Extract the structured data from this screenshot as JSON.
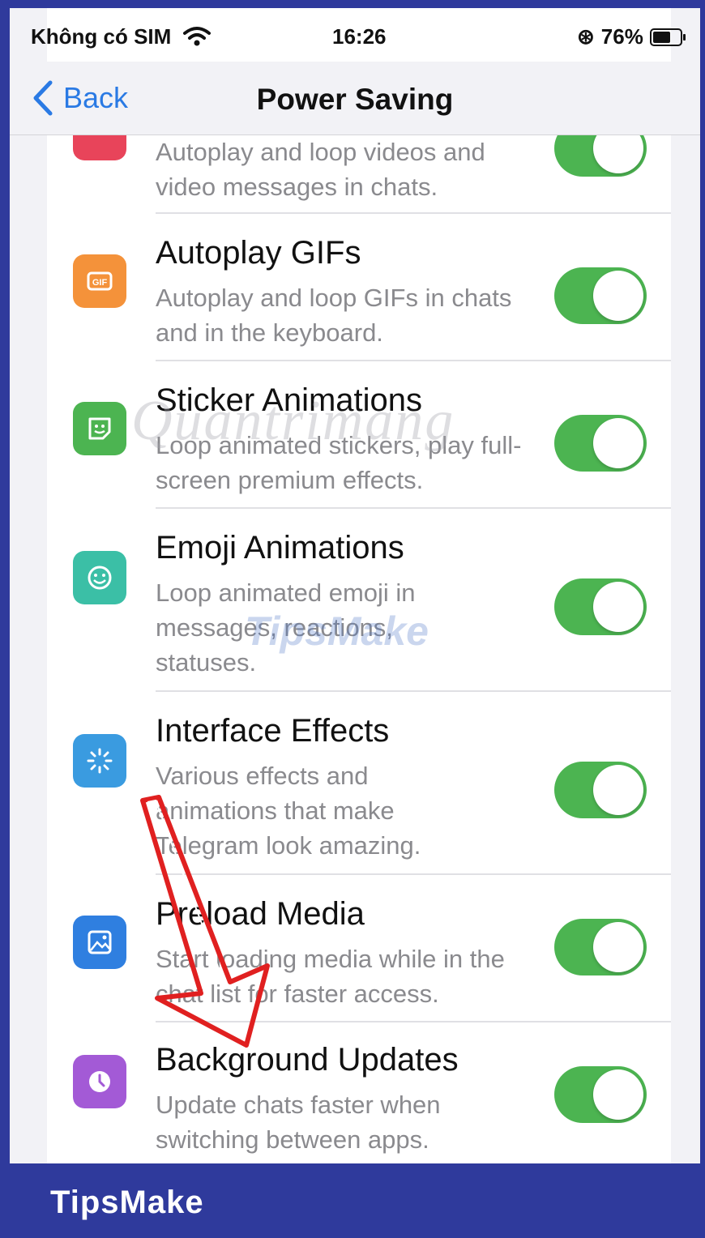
{
  "status_bar": {
    "carrier": "Không có SIM",
    "time": "16:26",
    "battery": "76%",
    "battery_level": 0.76
  },
  "nav": {
    "back_label": "Back",
    "title": "Power Saving"
  },
  "rows": [
    {
      "title": "",
      "desc": "Autoplay and loop videos and video messages in chats.",
      "icon": "video-icon",
      "color": "#e8445a",
      "on": true
    },
    {
      "title": "Autoplay GIFs",
      "desc": "Autoplay and loop GIFs in chats and in the keyboard.",
      "icon": "gif-icon",
      "color": "#f4923a",
      "on": true
    },
    {
      "title": "Sticker Animations",
      "desc": "Loop animated stickers, play full-screen premium effects.",
      "icon": "sticker-icon",
      "color": "#4cb451",
      "on": true
    },
    {
      "title": "Emoji Animations",
      "desc": "Loop animated emoji in messages, reactions, statuses.",
      "icon": "emoji-icon",
      "color": "#3bbfa6",
      "on": true
    },
    {
      "title": "Interface Effects",
      "desc": "Various effects and animations that make Telegram look amazing.",
      "icon": "sparkle-icon",
      "color": "#3a9be0",
      "on": true
    },
    {
      "title": "Preload Media",
      "desc": "Start loading media while in the chat list for faster access.",
      "icon": "image-icon",
      "color": "#2f7fe0",
      "on": true
    },
    {
      "title": "Background Updates",
      "desc": "Update chats faster when switching between apps.",
      "icon": "clock-icon",
      "color": "#a35ad6",
      "on": true
    }
  ],
  "watermark": {
    "text1": "Quantrimang",
    "text2": "TipsMake"
  },
  "footer": {
    "brand": "TipsMake"
  },
  "colors": {
    "accent": "#2a7ae4",
    "toggle_on": "#4cb451",
    "footer_bg": "#2f3a9c"
  }
}
